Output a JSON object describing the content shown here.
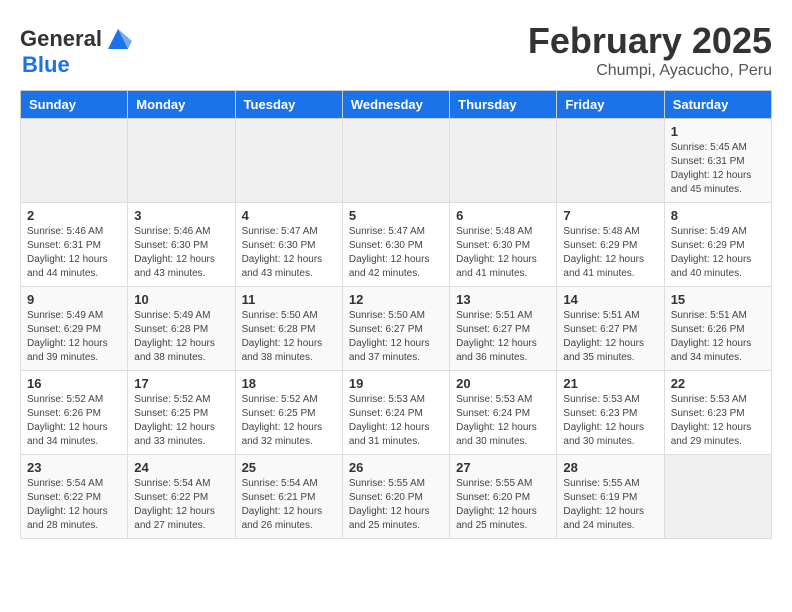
{
  "logo": {
    "line1": "General",
    "line2": "Blue"
  },
  "title": "February 2025",
  "subtitle": "Chumpi, Ayacucho, Peru",
  "days_of_week": [
    "Sunday",
    "Monday",
    "Tuesday",
    "Wednesday",
    "Thursday",
    "Friday",
    "Saturday"
  ],
  "weeks": [
    [
      {
        "day": "",
        "info": ""
      },
      {
        "day": "",
        "info": ""
      },
      {
        "day": "",
        "info": ""
      },
      {
        "day": "",
        "info": ""
      },
      {
        "day": "",
        "info": ""
      },
      {
        "day": "",
        "info": ""
      },
      {
        "day": "1",
        "info": "Sunrise: 5:45 AM\nSunset: 6:31 PM\nDaylight: 12 hours and 45 minutes."
      }
    ],
    [
      {
        "day": "2",
        "info": "Sunrise: 5:46 AM\nSunset: 6:31 PM\nDaylight: 12 hours and 44 minutes."
      },
      {
        "day": "3",
        "info": "Sunrise: 5:46 AM\nSunset: 6:30 PM\nDaylight: 12 hours and 43 minutes."
      },
      {
        "day": "4",
        "info": "Sunrise: 5:47 AM\nSunset: 6:30 PM\nDaylight: 12 hours and 43 minutes."
      },
      {
        "day": "5",
        "info": "Sunrise: 5:47 AM\nSunset: 6:30 PM\nDaylight: 12 hours and 42 minutes."
      },
      {
        "day": "6",
        "info": "Sunrise: 5:48 AM\nSunset: 6:30 PM\nDaylight: 12 hours and 41 minutes."
      },
      {
        "day": "7",
        "info": "Sunrise: 5:48 AM\nSunset: 6:29 PM\nDaylight: 12 hours and 41 minutes."
      },
      {
        "day": "8",
        "info": "Sunrise: 5:49 AM\nSunset: 6:29 PM\nDaylight: 12 hours and 40 minutes."
      }
    ],
    [
      {
        "day": "9",
        "info": "Sunrise: 5:49 AM\nSunset: 6:29 PM\nDaylight: 12 hours and 39 minutes."
      },
      {
        "day": "10",
        "info": "Sunrise: 5:49 AM\nSunset: 6:28 PM\nDaylight: 12 hours and 38 minutes."
      },
      {
        "day": "11",
        "info": "Sunrise: 5:50 AM\nSunset: 6:28 PM\nDaylight: 12 hours and 38 minutes."
      },
      {
        "day": "12",
        "info": "Sunrise: 5:50 AM\nSunset: 6:27 PM\nDaylight: 12 hours and 37 minutes."
      },
      {
        "day": "13",
        "info": "Sunrise: 5:51 AM\nSunset: 6:27 PM\nDaylight: 12 hours and 36 minutes."
      },
      {
        "day": "14",
        "info": "Sunrise: 5:51 AM\nSunset: 6:27 PM\nDaylight: 12 hours and 35 minutes."
      },
      {
        "day": "15",
        "info": "Sunrise: 5:51 AM\nSunset: 6:26 PM\nDaylight: 12 hours and 34 minutes."
      }
    ],
    [
      {
        "day": "16",
        "info": "Sunrise: 5:52 AM\nSunset: 6:26 PM\nDaylight: 12 hours and 34 minutes."
      },
      {
        "day": "17",
        "info": "Sunrise: 5:52 AM\nSunset: 6:25 PM\nDaylight: 12 hours and 33 minutes."
      },
      {
        "day": "18",
        "info": "Sunrise: 5:52 AM\nSunset: 6:25 PM\nDaylight: 12 hours and 32 minutes."
      },
      {
        "day": "19",
        "info": "Sunrise: 5:53 AM\nSunset: 6:24 PM\nDaylight: 12 hours and 31 minutes."
      },
      {
        "day": "20",
        "info": "Sunrise: 5:53 AM\nSunset: 6:24 PM\nDaylight: 12 hours and 30 minutes."
      },
      {
        "day": "21",
        "info": "Sunrise: 5:53 AM\nSunset: 6:23 PM\nDaylight: 12 hours and 30 minutes."
      },
      {
        "day": "22",
        "info": "Sunrise: 5:53 AM\nSunset: 6:23 PM\nDaylight: 12 hours and 29 minutes."
      }
    ],
    [
      {
        "day": "23",
        "info": "Sunrise: 5:54 AM\nSunset: 6:22 PM\nDaylight: 12 hours and 28 minutes."
      },
      {
        "day": "24",
        "info": "Sunrise: 5:54 AM\nSunset: 6:22 PM\nDaylight: 12 hours and 27 minutes."
      },
      {
        "day": "25",
        "info": "Sunrise: 5:54 AM\nSunset: 6:21 PM\nDaylight: 12 hours and 26 minutes."
      },
      {
        "day": "26",
        "info": "Sunrise: 5:55 AM\nSunset: 6:20 PM\nDaylight: 12 hours and 25 minutes."
      },
      {
        "day": "27",
        "info": "Sunrise: 5:55 AM\nSunset: 6:20 PM\nDaylight: 12 hours and 25 minutes."
      },
      {
        "day": "28",
        "info": "Sunrise: 5:55 AM\nSunset: 6:19 PM\nDaylight: 12 hours and 24 minutes."
      },
      {
        "day": "",
        "info": ""
      }
    ]
  ]
}
